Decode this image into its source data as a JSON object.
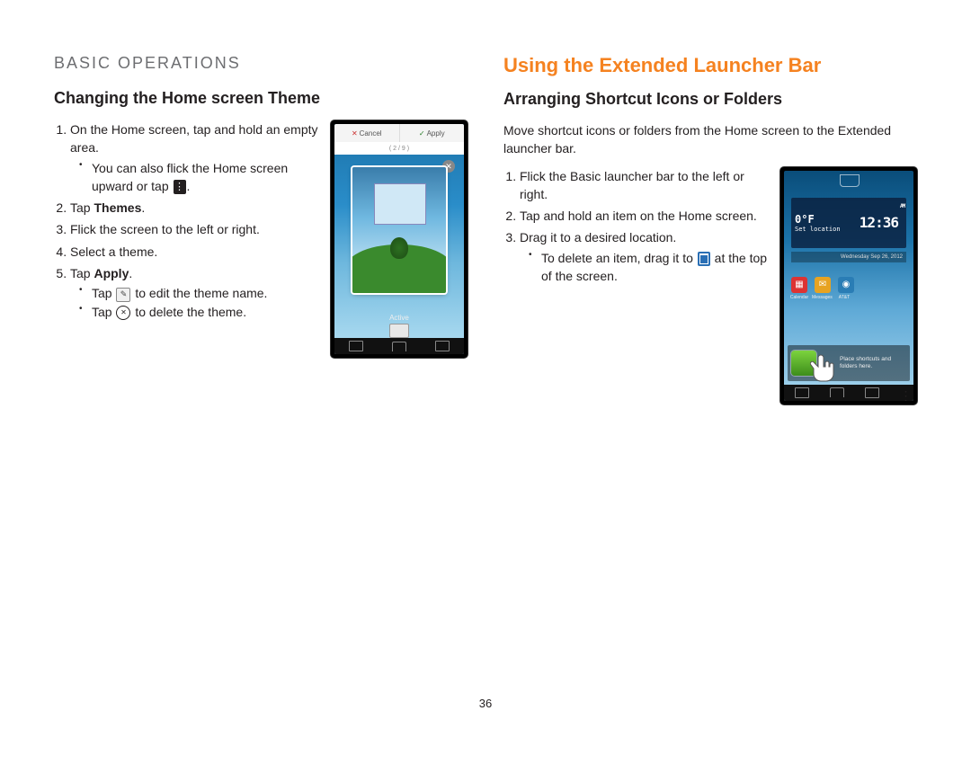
{
  "section_label": "BASIC OPERATIONS",
  "page_number": "36",
  "left": {
    "heading": "Changing the Home screen Theme",
    "step1": "On the Home screen, tap and hold an empty area.",
    "step1_sub_pre": "You can also flick the Home screen upward or tap ",
    "step1_sub_post": ".",
    "step2_pre": "Tap ",
    "step2_bold": "Themes",
    "step2_post": ".",
    "step3": "Flick the screen to the left or right.",
    "step4": "Select a theme.",
    "step5_pre": "Tap ",
    "step5_bold": "Apply",
    "step5_post": ".",
    "step5_sub1_pre": "Tap ",
    "step5_sub1_post": " to edit the theme name.",
    "step5_sub2_pre": "Tap ",
    "step5_sub2_post": " to delete the theme.",
    "mock": {
      "cancel": "Cancel",
      "apply": "Apply",
      "counter": "( 2 / 9 )",
      "active": "Active"
    }
  },
  "right": {
    "heading": "Using the Extended Launcher Bar",
    "subheading": "Arranging Shortcut Icons or Folders",
    "intro": "Move shortcut icons or folders from the Home screen to the Extended launcher bar.",
    "step1": "Flick the Basic launcher bar to the left or right.",
    "step2": "Tap and hold an item on the Home screen.",
    "step3": "Drag it to a desired location.",
    "step3_sub_pre": "To delete an item, drag it to ",
    "step3_sub_post": " at the top of the screen.",
    "mock": {
      "temp": "0°F",
      "temp_sub": "Set location",
      "clock": "12:36",
      "ampm": "AM",
      "date": "Wednesday   Sep 26, 2012",
      "dock_app1": "Calendar",
      "dock_app2": "Messages",
      "dock_app3": "AT&T",
      "launcher_hint": "Place shortcuts and folders here."
    }
  }
}
